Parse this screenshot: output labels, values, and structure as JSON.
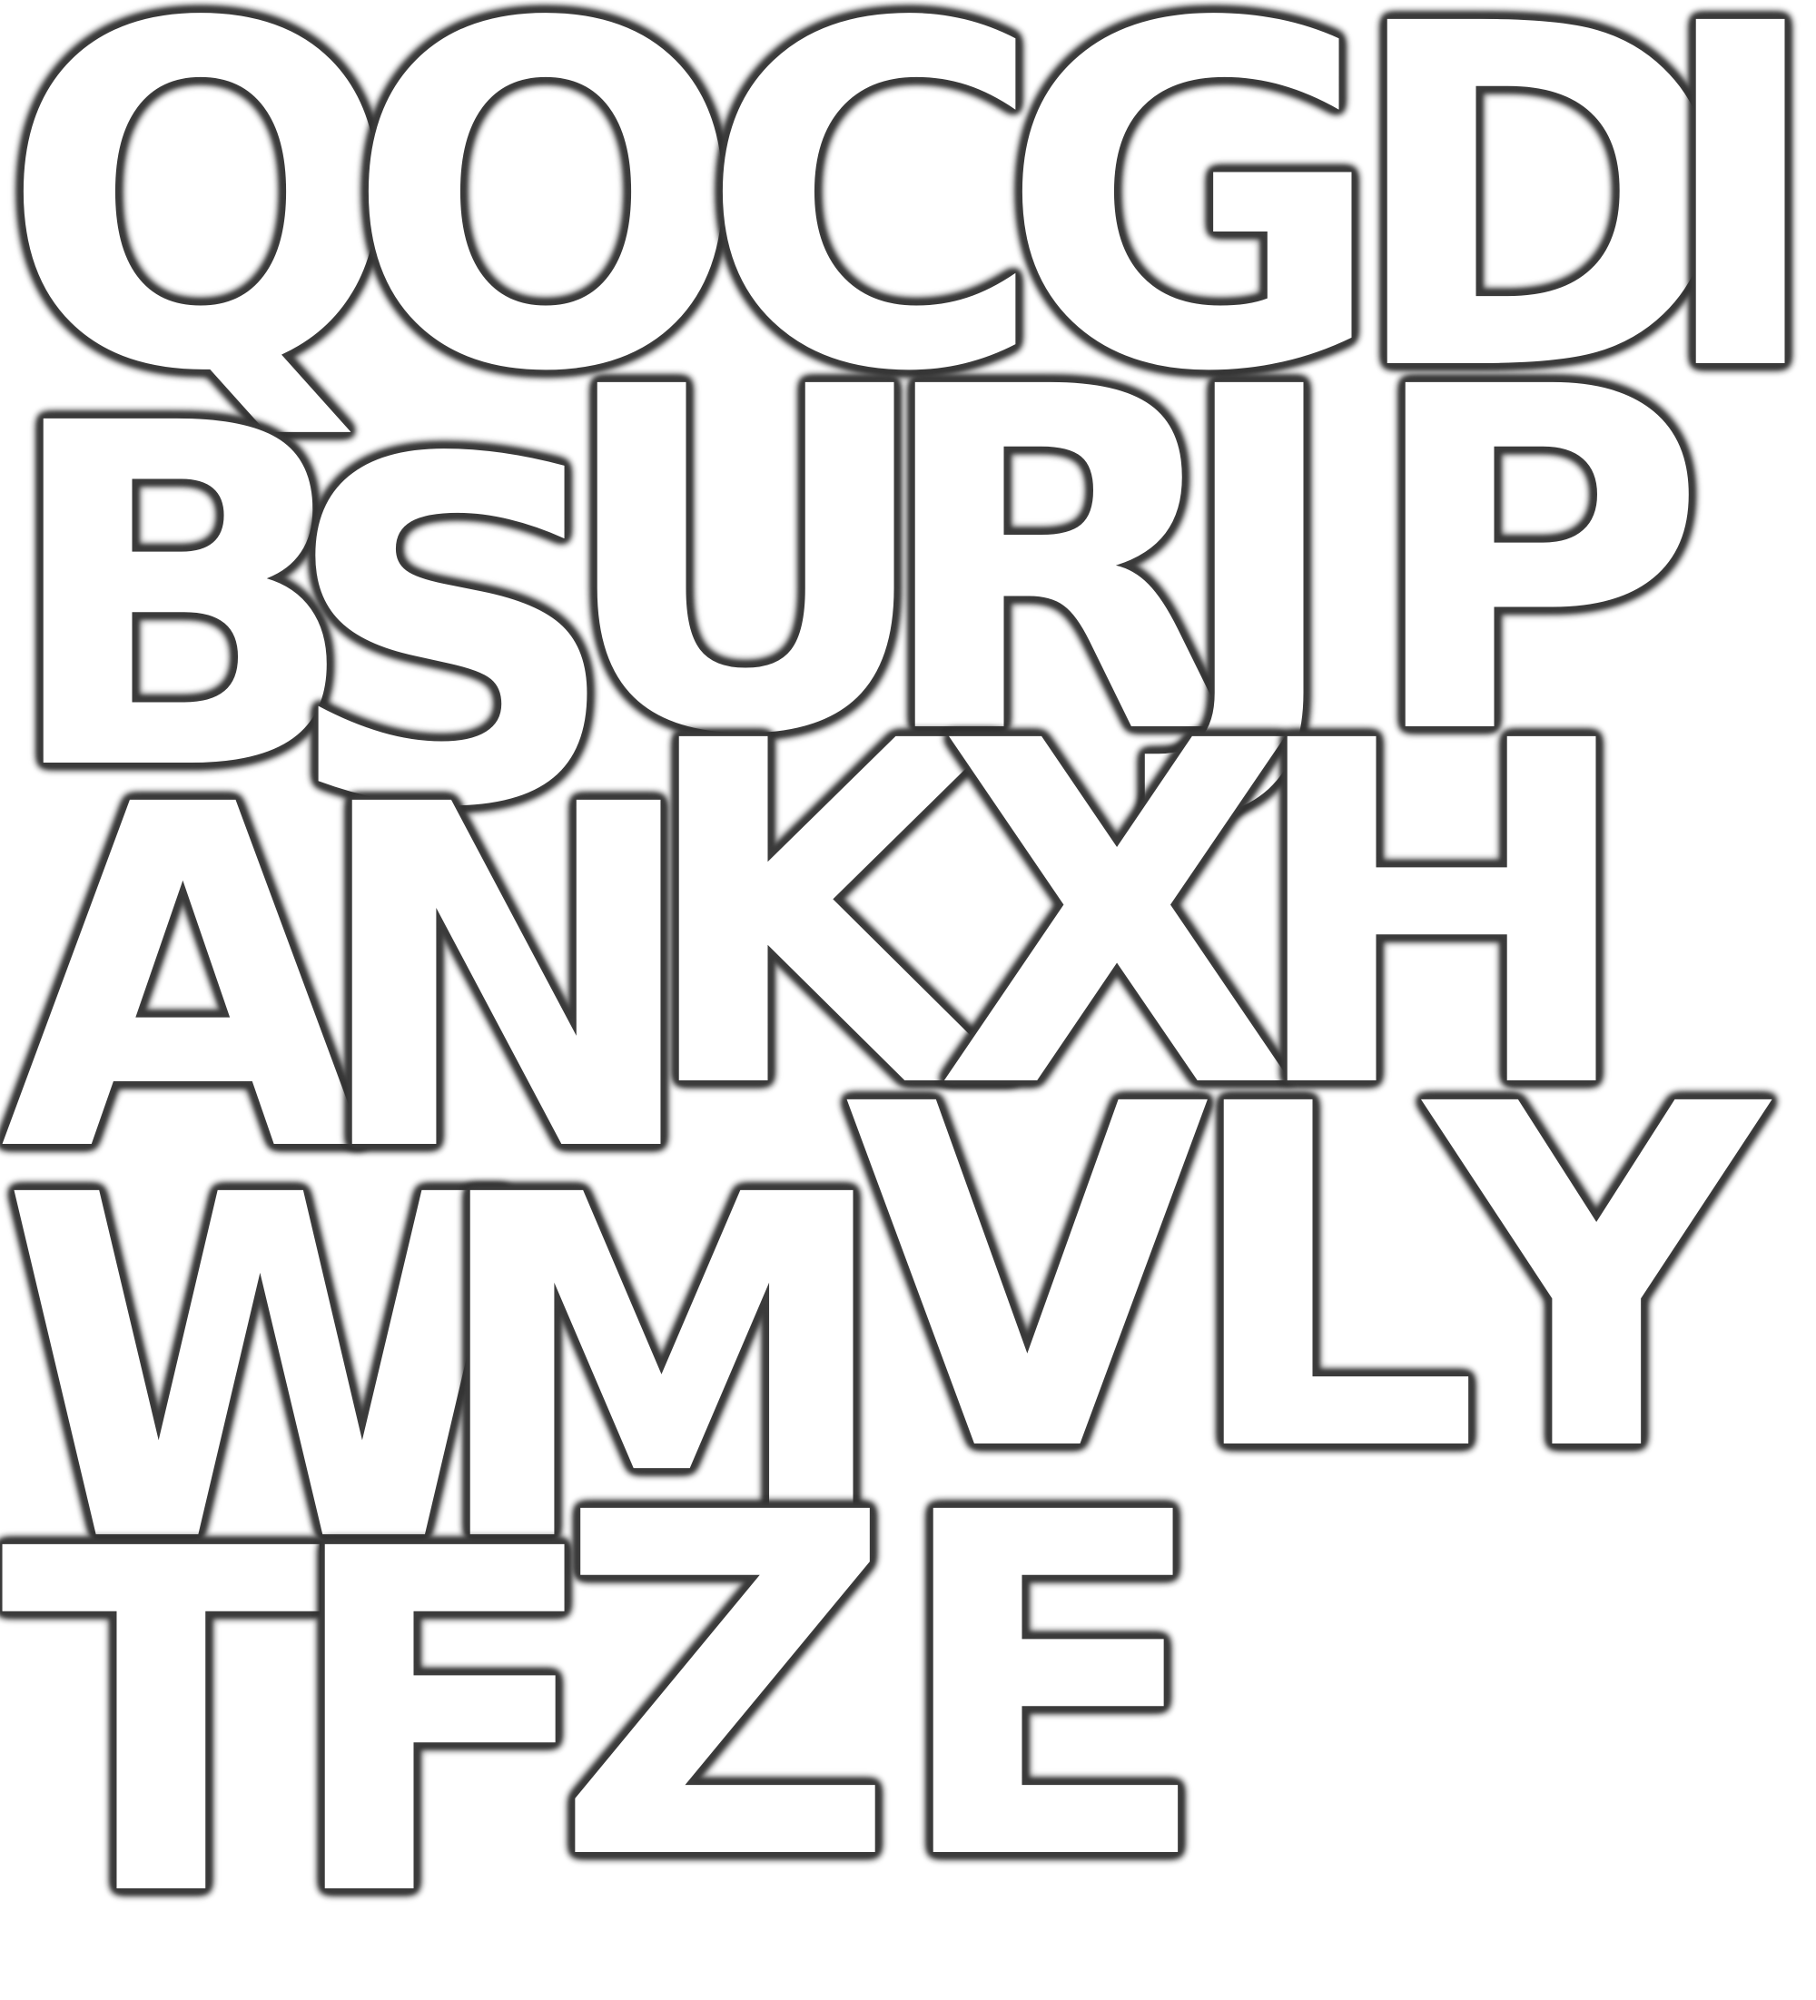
{
  "letters": [
    {
      "char": "Q"
    },
    {
      "char": "O"
    },
    {
      "char": "C"
    },
    {
      "char": "G"
    },
    {
      "char": "D"
    },
    {
      "char": "I"
    },
    {
      "char": "B"
    },
    {
      "char": "S"
    },
    {
      "char": "U"
    },
    {
      "char": "R"
    },
    {
      "char": "J"
    },
    {
      "char": "P"
    },
    {
      "char": "A"
    },
    {
      "char": "N"
    },
    {
      "char": "K"
    },
    {
      "char": "X"
    },
    {
      "char": "H"
    },
    {
      "char": "W"
    },
    {
      "char": "M"
    },
    {
      "char": "V"
    },
    {
      "char": "L"
    },
    {
      "char": "Y"
    },
    {
      "char": "T"
    },
    {
      "char": "F"
    },
    {
      "char": "Z"
    },
    {
      "char": "E"
    }
  ],
  "colors": {
    "background": "#ffffff",
    "letter_fill": "#ffffff",
    "letter_outline": "#3d3d3d"
  }
}
